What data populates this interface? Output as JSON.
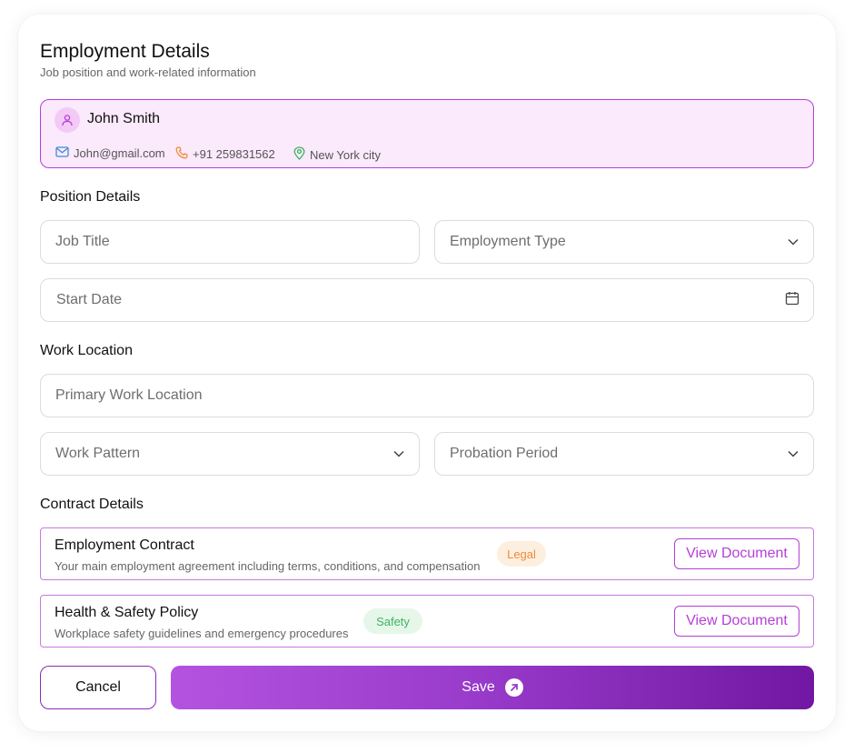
{
  "header": {
    "title": "Employment Details",
    "subtitle": "Job position and work-related information"
  },
  "profile": {
    "name": "John Smith",
    "email": "John@gmail.com",
    "phone": "+91 259831562",
    "location": "New York city",
    "icons": [
      "user-icon",
      "mail-icon",
      "phone-icon",
      "location-pin-icon"
    ]
  },
  "position_details": {
    "heading": "Position Details",
    "job_title_placeholder": "Job Title",
    "employment_type_placeholder": "Employment Type",
    "start_date_placeholder": "Start Date"
  },
  "work_location": {
    "heading": "Work Location",
    "primary_location_placeholder": "Primary Work Location",
    "work_pattern_placeholder": "Work Pattern",
    "probation_period_placeholder": "Probation Period"
  },
  "contract_details": {
    "heading": "Contract Details",
    "documents": [
      {
        "title": "Employment Contract",
        "description": "Your main employment agreement including terms, conditions, and compensation",
        "badge": "Legal",
        "badge_bg": "#fdefdf",
        "badge_color": "#f08c3a",
        "action": "View Document"
      },
      {
        "title": "Health & Safety Policy",
        "description": "Workplace safety guidelines and emergency procedures",
        "badge": "Safety",
        "badge_bg": "#e6f7ea",
        "badge_color": "#3cb45e",
        "action": "View Document"
      }
    ]
  },
  "actions": {
    "cancel_label": "Cancel",
    "save_label": "Save"
  },
  "colors": {
    "accent": "#b43fd7",
    "profile_bg": "#fbe9fc",
    "save_gradient_start": "#b453e0",
    "save_gradient_end": "#7117a3"
  }
}
